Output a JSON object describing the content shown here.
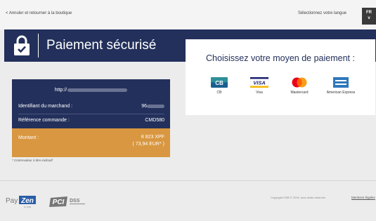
{
  "topbar": {
    "back_link": "< Annuler et retourner à la boutique",
    "language_label": "Sélectionnez votre langue",
    "language_code": "FR",
    "language_chevron": "v"
  },
  "band": {
    "title": "Paiement sécurisé",
    "icon": "padlock-check-icon"
  },
  "payment": {
    "title": "Choisissez votre moyen de paiement :",
    "methods": [
      {
        "label": "CB",
        "logo": "cb-logo",
        "logo_text": "CB"
      },
      {
        "label": "Visa",
        "logo": "visa-logo",
        "logo_text": "VISA"
      },
      {
        "label": "Mastercard",
        "logo": "mastercard-logo"
      },
      {
        "label": "American Express",
        "logo": "amex-logo"
      }
    ]
  },
  "merchant": {
    "url_prefix": "http://",
    "id_label": "Identifiant du marchand :",
    "id_value_prefix": "96",
    "order_label": "Référence commande :",
    "order_value": "CMD580",
    "amount_label": "Montant :",
    "amount_value": "8 823 XPF",
    "amount_converted": "( 73,94 EUR* )",
    "note": "* Contrevaleur à titre indicatif"
  },
  "footer": {
    "payzen_text": "Pay",
    "payzen_badge": "Zen",
    "payzen_sub": "by OSB",
    "pci_text": "PCI",
    "dss_text": "DSS",
    "copyright": "Copyright OSB © 2016. tous droits réservés",
    "legal_link": "Mentions légales"
  },
  "colors": {
    "navy": "#23305b",
    "orange": "#d89740",
    "payzen_blue": "#2b5ea8"
  }
}
